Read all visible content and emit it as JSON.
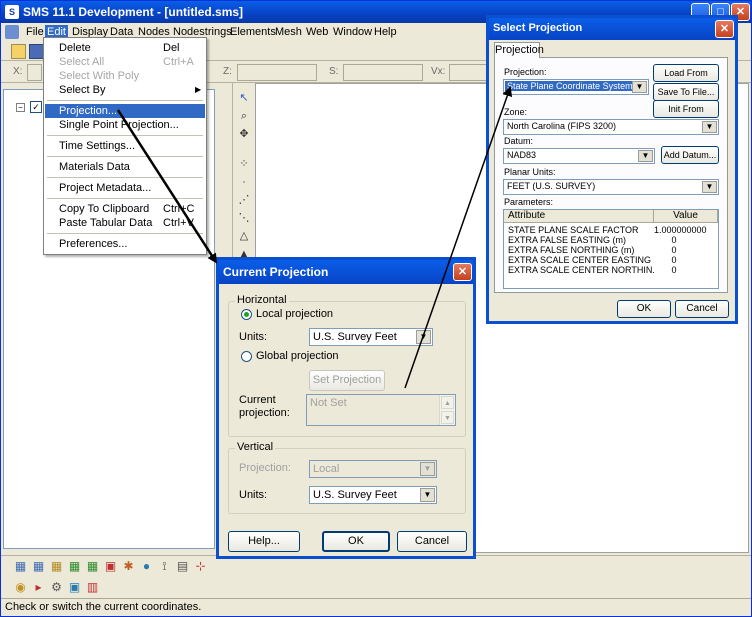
{
  "window": {
    "title": "SMS 11.1 Development - [untitled.sms]"
  },
  "menubar": [
    "File",
    "Edit",
    "Display",
    "Data",
    "Nodes",
    "Nodestrings",
    "Elements",
    "Mesh",
    "Web",
    "Window",
    "Help"
  ],
  "coords": {
    "x_label": "X:",
    "z_label": "Z:",
    "s_label": "S:",
    "vx_label": "Vx:"
  },
  "edit_menu": {
    "items": [
      {
        "label": "Delete",
        "shortcut": "Del"
      },
      {
        "label": "Select All",
        "shortcut": "Ctrl+A"
      },
      {
        "label": "Select With Poly",
        "shortcut": ""
      },
      {
        "label": "Select By",
        "shortcut": ""
      },
      {
        "label": "Projection...",
        "shortcut": ""
      },
      {
        "label": "Single Point Projection...",
        "shortcut": ""
      },
      {
        "label": "Time Settings...",
        "shortcut": ""
      },
      {
        "label": "Materials Data",
        "shortcut": ""
      },
      {
        "label": "Project Metadata...",
        "shortcut": ""
      },
      {
        "label": "Copy To Clipboard",
        "shortcut": "Ctrl+C"
      },
      {
        "label": "Paste Tabular Data",
        "shortcut": "Ctrl+V"
      },
      {
        "label": "Preferences...",
        "shortcut": ""
      }
    ]
  },
  "current_projection": {
    "title": "Current Projection",
    "horizontal_legend": "Horizontal",
    "local_label": "Local projection",
    "units_label": "Units:",
    "units_value": "U.S. Survey Feet",
    "global_label": "Global projection",
    "set_projection": "Set Projection",
    "current_label_1": "Current",
    "current_label_2": "projection:",
    "current_value": "Not Set",
    "vertical_legend": "Vertical",
    "v_projection_label": "Projection:",
    "v_projection_value": "Local",
    "v_units_label": "Units:",
    "v_units_value": "U.S. Survey Feet",
    "help": "Help...",
    "ok": "OK",
    "cancel": "Cancel"
  },
  "select_projection": {
    "title": "Select Projection",
    "tab": "Projection",
    "projection_label": "Projection:",
    "projection_value": "State Plane Coordinate System",
    "load_btn": "Load From File...",
    "save_btn": "Save To File...",
    "epsg_btn": "Init From EPSG...",
    "zone_label": "Zone:",
    "zone_value": "North Carolina (FIPS 3200)",
    "datum_label": "Datum:",
    "datum_value": "NAD83",
    "add_datum": "Add Datum...",
    "planar_label": "Planar Units:",
    "planar_value": "FEET (U.S. SURVEY)",
    "parameters_label": "Parameters:",
    "param_headers": {
      "attribute": "Attribute",
      "value": "Value"
    },
    "params": [
      {
        "attribute": "STATE PLANE SCALE FACTOR",
        "value": "1.000000000"
      },
      {
        "attribute": "EXTRA FALSE EASTING (m)",
        "value": "0"
      },
      {
        "attribute": "EXTRA FALSE NORTHING (m)",
        "value": "0"
      },
      {
        "attribute": "EXTRA SCALE CENTER EASTING (...",
        "value": "0"
      },
      {
        "attribute": "EXTRA SCALE CENTER NORTHIN...",
        "value": "0"
      }
    ],
    "ok": "OK",
    "cancel": "Cancel"
  },
  "status": {
    "text": "Check or switch the current coordinates."
  }
}
